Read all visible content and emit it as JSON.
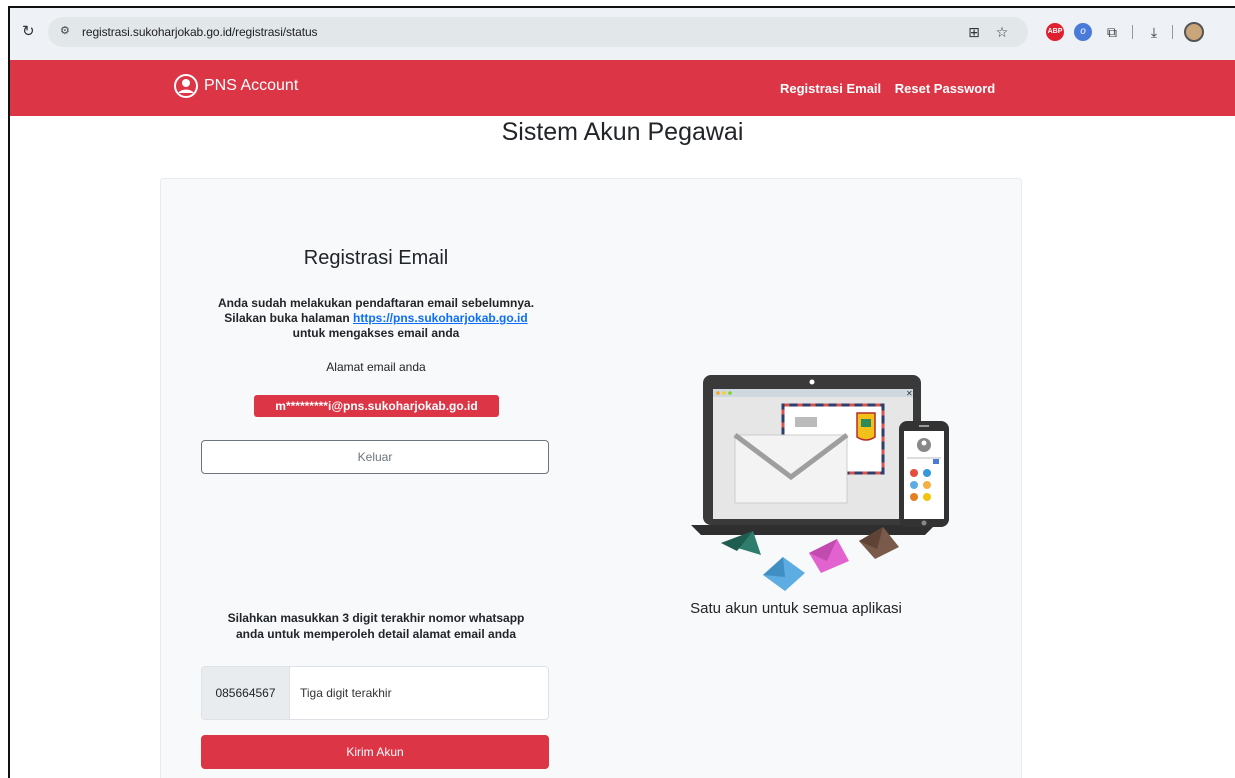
{
  "browser": {
    "url": "registrasi.sukoharjokab.go.id/registrasi/status"
  },
  "navbar": {
    "brand": "PNS Account",
    "links": [
      "Registrasi Email",
      "Reset Password"
    ],
    "color": "#dc3545"
  },
  "page": {
    "title": "Sistem Akun Pegawai"
  },
  "registration": {
    "heading": "Registrasi Email",
    "notice_line1": "Anda sudah melakukan pendaftaran email sebelumnya.",
    "notice_line2_prefix": "Silakan buka halaman ",
    "notice_link": "https://pns.sukoharjokab.go.id",
    "notice_line3": "untuk mengakses email anda",
    "email_label": "Alamat email anda",
    "email_value": "m*********i@pns.sukoharjokab.go.id",
    "logout_label": "Keluar",
    "prompt_line1": "Silahkan masukkan 3 digit terakhir nomor whatsapp",
    "prompt_line2": "anda untuk memperoleh detail alamat email anda",
    "phone_prefix": "085664567",
    "phone_placeholder": "Tiga digit terakhir",
    "submit_label": "Kirim Akun"
  },
  "illustration": {
    "tagline": "Satu akun untuk semua aplikasi"
  }
}
